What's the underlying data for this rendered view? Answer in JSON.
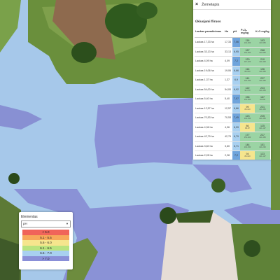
{
  "panel": {
    "title": "Žemelapis",
    "close_icon": "×",
    "filter_label": "Ūkiuojami fliruos",
    "columns": [
      "Laukas pavadinimas",
      "Ha",
      "pH",
      "P₂O₅ mg/kg",
      "K₂O mg/kg"
    ],
    "rows": [
      {
        "name": "Laukas 17,33 ha",
        "ha": "17,33",
        "ph": "7,06",
        "ph_c": "#6fa4dc",
        "p": "116",
        "p_sub": "101-200",
        "p_c": "#9bd4a4",
        "k": "193",
        "k_sub": "120-350",
        "k_c": "#9bd4a4"
      },
      {
        "name": "Laukas 33,13 ha",
        "ha": "33,13",
        "ph": "6,95",
        "ph_c": "#a8d0f0",
        "p": "167",
        "p_sub": "151-200",
        "p_c": "#9bd4a4",
        "k": "268",
        "k_sub": "120-350",
        "k_c": "#9bd4a4"
      },
      {
        "name": "Laukas 4,09 ha",
        "ha": "4,09",
        "ph": "7,2",
        "ph_c": "#6fa4dc",
        "p": "120",
        "p_sub": "117-120",
        "p_c": "#9bd4a4",
        "k": "210",
        "k_sub": "121-300",
        "k_c": "#9bd4a4"
      },
      {
        "name": "Laukas 19,06 ha",
        "ha": "19,06",
        "ph": "6,66",
        "ph_c": "#a8d0f0",
        "p": "116",
        "p_sub": "86-120",
        "p_c": "#9bd4a4",
        "k": "196",
        "k_sub": "121-350",
        "k_c": "#9bd4a4"
      },
      {
        "name": "Laukas 1,37 ha",
        "ha": "1,37",
        "ph": "6,9",
        "ph_c": "#a8d0f0",
        "p": "141",
        "p_sub": "101-150",
        "p_c": "#9bd4a4",
        "k": "227",
        "k_sub": "121-350",
        "k_c": "#9bd4a4"
      },
      {
        "name": "Laukas 54,00 ha",
        "ha": "54,00",
        "ph": "6,92",
        "ph_c": "#a8d0f0",
        "p": "122",
        "p_sub": "91-170",
        "p_c": "#9bd4a4",
        "k": "223",
        "k_sub": "121-350",
        "k_c": "#9bd4a4"
      },
      {
        "name": "Laukas 5,40 ha",
        "ha": "5,40",
        "ph": "7,07",
        "ph_c": "#6fa4dc",
        "p": "156",
        "p_sub": "151-200",
        "p_c": "#9bd4a4",
        "k": "167",
        "k_sub": "91-200",
        "k_c": "#9bd4a4"
      },
      {
        "name": "Laukas 12,57 ha",
        "ha": "12,57",
        "ph": "6,86",
        "ph_c": "#a8d0f0",
        "p": "99",
        "p_sub": "86-120",
        "p_c": "#f6e58d",
        "k": "221",
        "k_sub": "121-350",
        "k_c": "#9bd4a4"
      },
      {
        "name": "Laukas 70,53 ha",
        "ha": "70,53",
        "ph": "7,45",
        "ph_c": "#6fa4dc",
        "p": "123",
        "p_sub": "101-150",
        "p_c": "#9bd4a4",
        "k": "225",
        "k_sub": "121-350",
        "k_c": "#9bd4a4"
      },
      {
        "name": "Laukas 4,96 ha",
        "ha": "4,96",
        "ph": "6,99",
        "ph_c": "#a8d0f0",
        "p": "86",
        "p_sub": "86-87",
        "p_c": "#f6e58d",
        "k": "125",
        "k_sub": "121-127",
        "k_c": "#9bd4a4"
      },
      {
        "name": "Laukas 42,79 ha",
        "ha": "42,79",
        "ph": "6,79",
        "ph_c": "#a8d0f0",
        "p": "177",
        "p_sub": "151-200",
        "p_c": "#9bd4a4",
        "k": "227",
        "k_sub": "121-350",
        "k_c": "#9bd4a4"
      },
      {
        "name": "Laukas 3,60 ha",
        "ha": "3,60",
        "ph": "6,71",
        "ph_c": "#a8d0f0",
        "p": "144",
        "p_sub": "101-150",
        "p_c": "#9bd4a4",
        "k": "151",
        "k_sub": "121-200",
        "k_c": "#9bd4a4"
      },
      {
        "name": "Laukas 2,28 ha",
        "ha": "2,28",
        "ph": "7,2",
        "ph_c": "#6fa4dc",
        "p": "94",
        "p_sub": "86-120",
        "p_c": "#f6e58d",
        "k": "123",
        "k_sub": "121-127",
        "k_c": "#9bd4a4"
      },
      {
        "name": "Laukas 11,69 ha",
        "ha": "11,69",
        "ph": "6,72",
        "ph_c": "#a8d0f0",
        "p": "107",
        "p_sub": "101-120",
        "p_c": "#9bd4a4",
        "k": "310",
        "k_sub": "121-350",
        "k_c": "#9bd4a4"
      }
    ]
  },
  "legend": {
    "title": "Elementas",
    "selected": "pH",
    "arrow_icon": "▼",
    "items": [
      {
        "label": "< 5.0",
        "color": "#f0645a"
      },
      {
        "label": "5.1 - 5.5",
        "color": "#f7a85a"
      },
      {
        "label": "5.6 - 6.0",
        "color": "#f6e58d"
      },
      {
        "label": "6.1 - 6.5",
        "color": "#b9e37e"
      },
      {
        "label": "6.6 - 7.0",
        "color": "#a8d0f0"
      },
      {
        "label": "> 7.0",
        "color": "#8a8fd8"
      }
    ]
  }
}
